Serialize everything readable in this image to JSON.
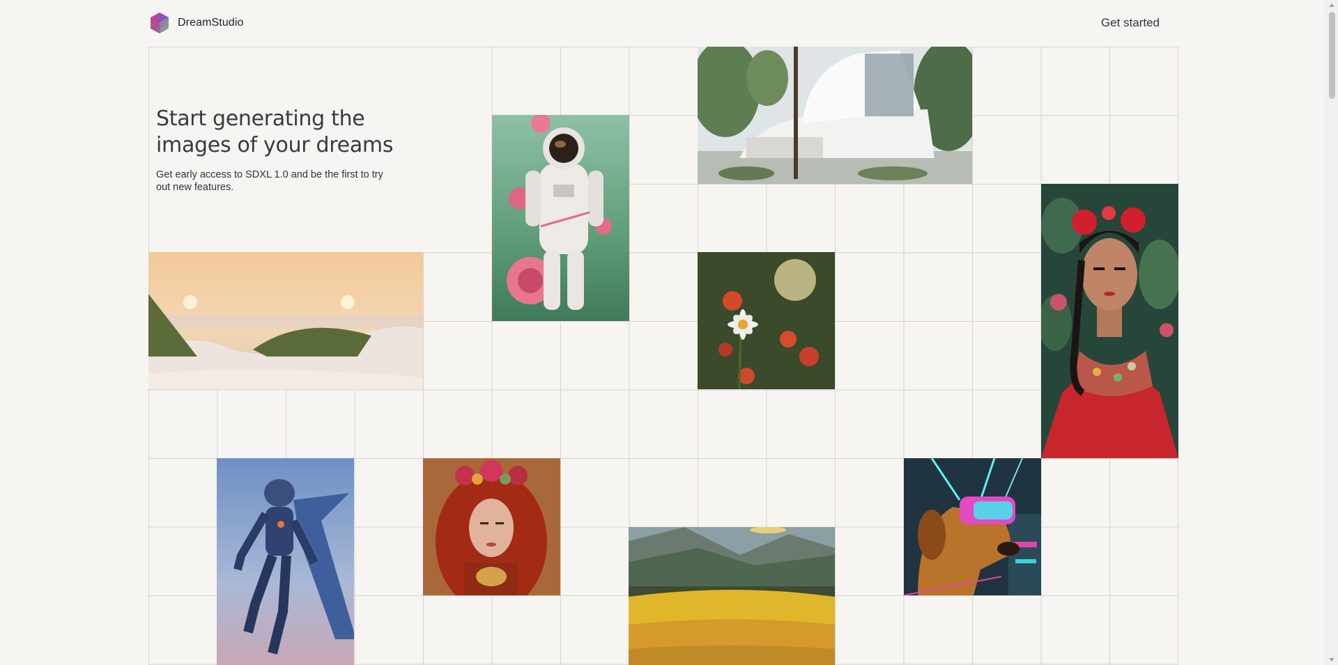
{
  "header": {
    "brand_name": "DreamStudio",
    "brand_icon": "hexagon-gradient-logo",
    "cta_label": "Get started"
  },
  "hero": {
    "title": "Start generating the images of your dreams",
    "subtitle": "Get early access to SDXL 1.0 and be the first to try out new features."
  },
  "gallery": {
    "images": [
      {
        "id": "astronaut",
        "subject": "astronaut among roses"
      },
      {
        "id": "modern-house",
        "subject": "white modern house among trees"
      },
      {
        "id": "frida",
        "subject": "woman with red flowers in hair"
      },
      {
        "id": "beach-dunes",
        "subject": "sunset over sand dunes"
      },
      {
        "id": "daisy",
        "subject": "daisy among red flowers"
      },
      {
        "id": "armored-figure",
        "subject": "armored flying figure"
      },
      {
        "id": "redhead",
        "subject": "redhead woman with flower crown"
      },
      {
        "id": "dog-vr",
        "subject": "dog wearing VR headset"
      },
      {
        "id": "flower-valley",
        "subject": "valley of yellow flowers"
      }
    ]
  },
  "colors": {
    "background": "#f7f5f2",
    "grid_line": "#d6d3cf",
    "text_primary": "#222222"
  }
}
